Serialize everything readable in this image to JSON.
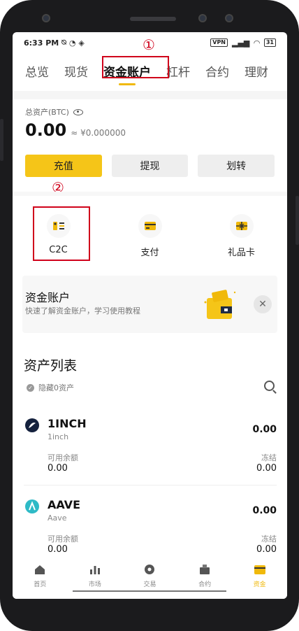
{
  "status_bar": {
    "time": "6:33 PM",
    "vpn": "VPN",
    "battery": "31"
  },
  "tabs": [
    "总览",
    "现货",
    "资金账户",
    "杠杆",
    "合约",
    "理财"
  ],
  "annotations": {
    "one": "①",
    "two": "②"
  },
  "summary": {
    "total_label": "总资产(BTC)",
    "total_value": "0.00",
    "fiat_value": "≈ ¥0.000000"
  },
  "actions": {
    "deposit": "充值",
    "withdraw": "提现",
    "transfer": "划转"
  },
  "quick": {
    "c2c": "C2C",
    "pay": "支付",
    "gift_card": "礼品卡"
  },
  "banner": {
    "title": "资金账户",
    "subtitle": "快速了解资金账户，学习使用教程",
    "close": "✕"
  },
  "asset_list": {
    "title": "资产列表",
    "hide_zero": "隐藏0资产",
    "available_label": "可用余额",
    "frozen_label": "冻结",
    "items": [
      {
        "symbol": "1INCH",
        "name": "1inch",
        "total": "0.00",
        "available": "0.00",
        "frozen": "0.00"
      },
      {
        "symbol": "AAVE",
        "name": "Aave",
        "total": "0.00",
        "available": "0.00",
        "frozen": "0.00"
      }
    ]
  },
  "bottom_nav": [
    "首页",
    "市场",
    "交易",
    "合约",
    "资金"
  ],
  "colors": {
    "accent": "#f0b90b",
    "annotation": "#d0021b",
    "aave": "#2ebac6"
  }
}
